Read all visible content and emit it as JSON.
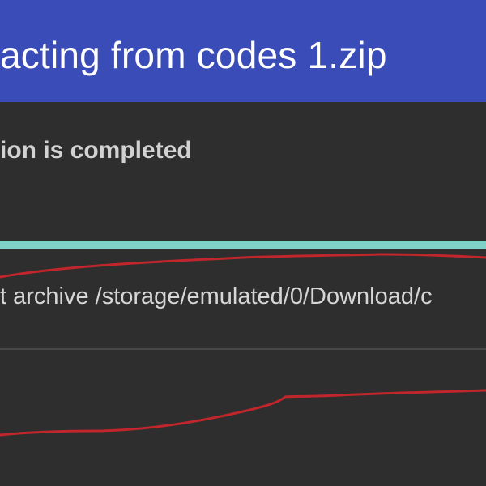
{
  "dialog": {
    "title": "acting from codes 1.zip",
    "status": "ion is completed",
    "progress_fraction": 1.0,
    "log_line": "t archive /storage/emulated/0/Download/c"
  },
  "colors": {
    "header_bg": "#3a4cb8",
    "body_bg": "#2e2e2e",
    "progress_fill": "#7ed1c7",
    "annotation_red": "#c0262b"
  },
  "annotations": {
    "type": "red-hand-drawn-underlines"
  }
}
